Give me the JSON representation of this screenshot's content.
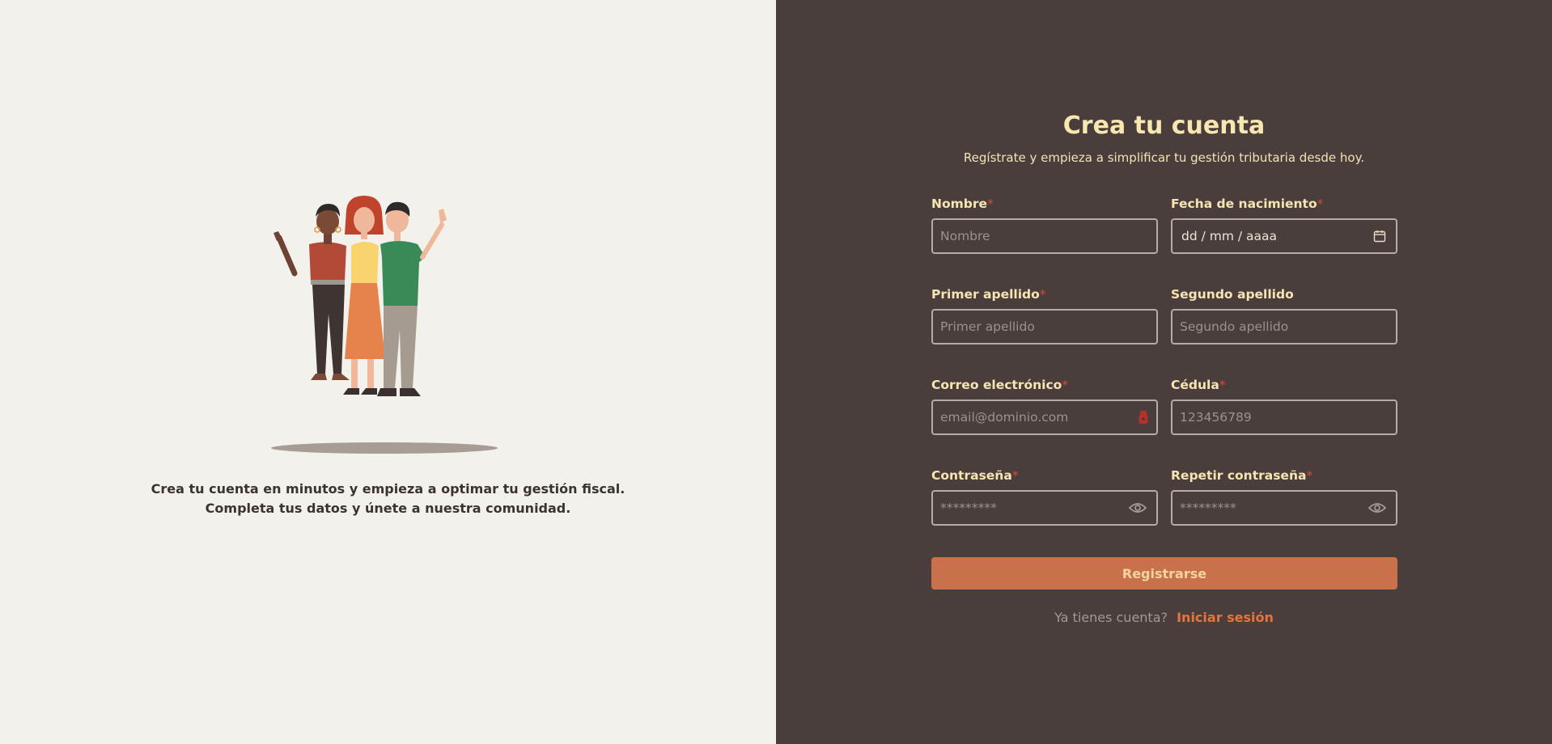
{
  "left": {
    "caption_line1": "Crea tu cuenta en minutos y empieza a optimar tu gestión fiscal.",
    "caption_line2": "Completa tus datos y únete a nuestra comunidad."
  },
  "form": {
    "title": "Crea tu cuenta",
    "subtitle": "Regístrate y empieza a simplificar tu gestión tributaria desde hoy.",
    "required_mark": "*",
    "fields": {
      "nombre": {
        "label": "Nombre",
        "placeholder": "Nombre",
        "required": true
      },
      "fecha_nacimiento": {
        "label": "Fecha de nacimiento",
        "value": "dd / mm / aaaa",
        "required": true,
        "icon": "calendar-icon"
      },
      "primer_apellido": {
        "label": "Primer apellido",
        "placeholder": "Primer apellido",
        "required": true
      },
      "segundo_apellido": {
        "label": "Segundo apellido",
        "placeholder": "Segundo apellido",
        "required": false
      },
      "correo": {
        "label": "Correo electrónico",
        "placeholder": "email@dominio.com",
        "required": true,
        "icon": "password-manager-icon"
      },
      "cedula": {
        "label": "Cédula",
        "placeholder": "123456789",
        "required": true
      },
      "contrasena": {
        "label": "Contraseña",
        "placeholder": "*********",
        "required": true,
        "icon": "eye-icon"
      },
      "repetir_contrasena": {
        "label": "Repetir contraseña",
        "placeholder": "*********",
        "required": true,
        "icon": "eye-icon"
      }
    },
    "submit_label": "Registrarse",
    "login_prompt": "Ya tienes cuenta?",
    "login_link": "Iniciar sesión"
  },
  "colors": {
    "left_bg": "#f3f1ec",
    "right_bg": "#4a3e3c",
    "accent": "#c8714a",
    "title": "#f8e7b0",
    "link": "#e8733c",
    "required": "#d24b3a"
  }
}
